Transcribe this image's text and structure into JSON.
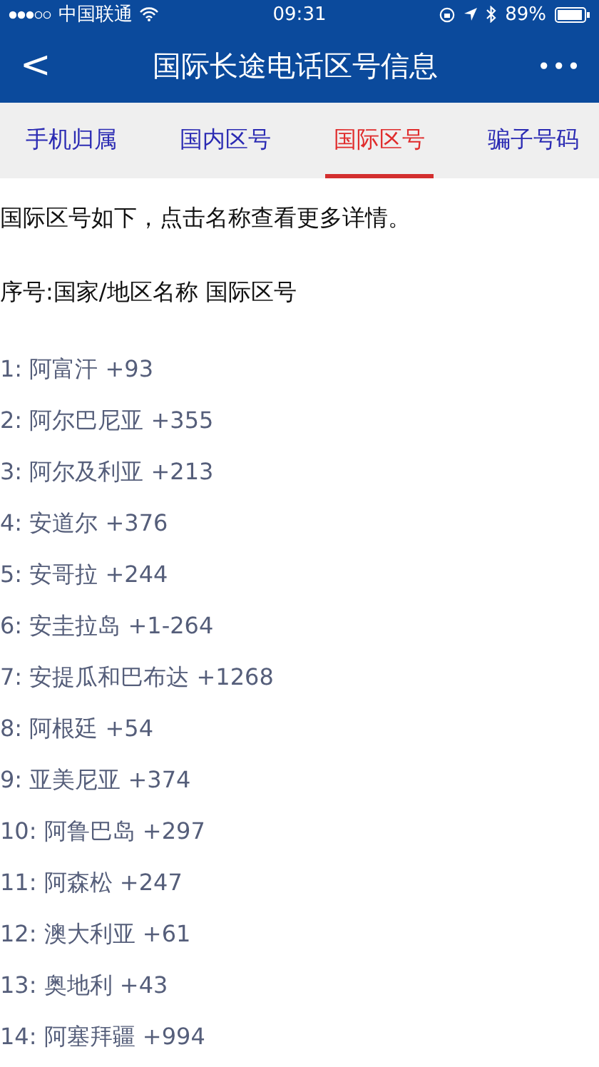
{
  "status_bar": {
    "carrier": "中国联通",
    "time": "09:31",
    "battery": "89%"
  },
  "nav": {
    "back": "<",
    "title": "国际长途电话区号信息",
    "more": "•••"
  },
  "tabs": [
    {
      "label": "手机归属",
      "selected": false
    },
    {
      "label": "国内区号",
      "selected": false
    },
    {
      "label": "国际区号",
      "selected": true
    },
    {
      "label": "骗子号码",
      "selected": false
    }
  ],
  "intro": "国际区号如下，点击名称查看更多详情。",
  "header": "序号:国家/地区名称 国际区号",
  "items": [
    "1: 阿富汗 +93",
    "2: 阿尔巴尼亚 +355",
    "3: 阿尔及利亚 +213",
    "4: 安道尔 +376",
    "5: 安哥拉 +244",
    "6: 安圭拉岛 +1-264",
    "7: 安提瓜和巴布达 +1268",
    "8: 阿根廷 +54",
    "9: 亚美尼亚 +374",
    "10: 阿鲁巴岛 +297",
    "11: 阿森松 +247",
    "12: 澳大利亚 +61",
    "13: 奥地利 +43",
    "14: 阿塞拜疆 +994"
  ]
}
